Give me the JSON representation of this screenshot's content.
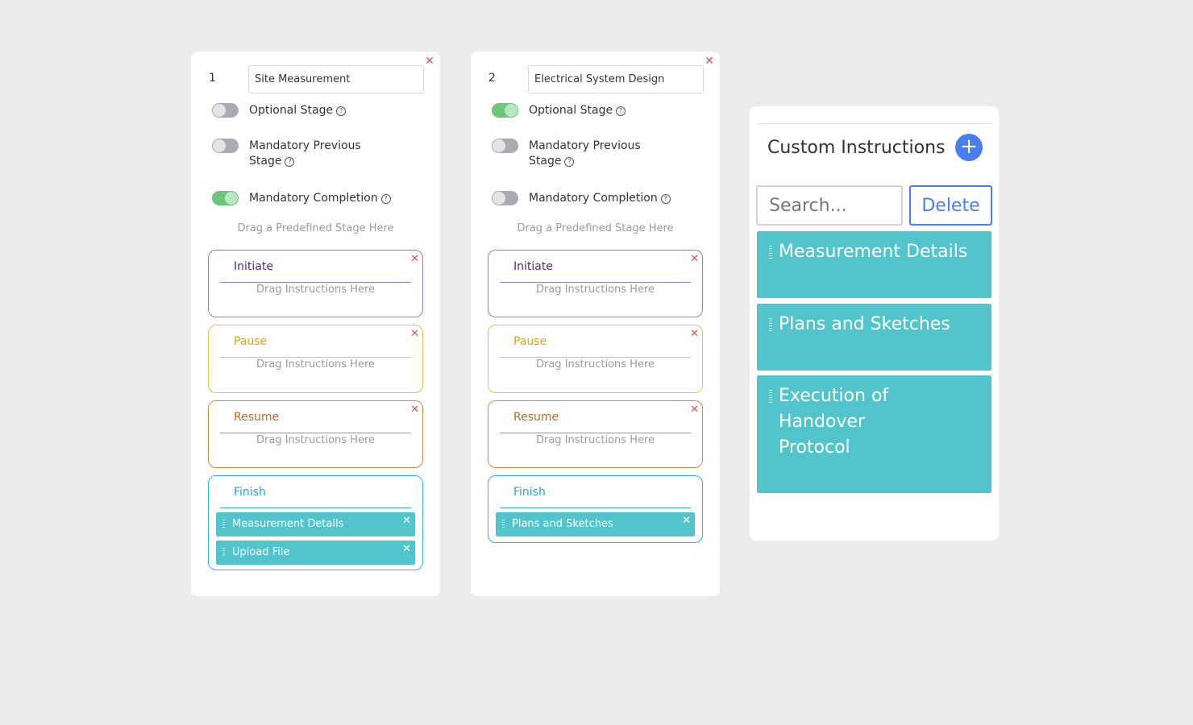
{
  "stages": [
    {
      "number": "1",
      "name": "Site Measurement",
      "options": [
        {
          "label": "Optional Stage",
          "on": false
        },
        {
          "label": "Mandatory Previous Stage",
          "on": false
        },
        {
          "label": "Mandatory Completion",
          "on": true
        }
      ],
      "drop_hint": "Drag a Predefined Stage Here",
      "sub_stages": {
        "initiate": {
          "title": "Initiate",
          "hint": "Drag Instructions Here"
        },
        "pause": {
          "title": "Pause",
          "hint": "Drag Instructions Here"
        },
        "resume": {
          "title": "Resume",
          "hint": "Drag Instructions Here"
        },
        "finish": {
          "title": "Finish",
          "items": [
            "Measurement Details",
            "Upload File"
          ]
        }
      }
    },
    {
      "number": "2",
      "name": "Electrical System Design",
      "options": [
        {
          "label": "Optional Stage",
          "on": true
        },
        {
          "label": "Mandatory Previous Stage",
          "on": false
        },
        {
          "label": "Mandatory Completion",
          "on": false
        }
      ],
      "drop_hint": "Drag a Predefined Stage Here",
      "sub_stages": {
        "initiate": {
          "title": "Initiate",
          "hint": "Drag Instructions Here"
        },
        "pause": {
          "title": "Pause",
          "hint": "Drag Instructions Here"
        },
        "resume": {
          "title": "Resume",
          "hint": "Drag Instructions Here"
        },
        "finish": {
          "title": "Finish",
          "items": [
            "Plans and Sketches"
          ]
        }
      }
    }
  ],
  "custom_instructions": {
    "title": "Custom Instructions",
    "search_placeholder": "Search...",
    "delete_label": "Delete",
    "items": [
      "Measurement Details",
      "Plans and Sketches",
      "Execution of Handover Protocol"
    ]
  },
  "icons": {
    "close": "close-icon",
    "help": "help-circle-icon",
    "add": "plus-icon",
    "drag": "drag-handle-icon"
  },
  "colors": {
    "teal": "#52c4cb",
    "accent_blue": "#4a7ef0",
    "initiate": "#9b7ab8",
    "pause": "#e2c34a",
    "resume": "#d08a3c",
    "finish": "#2fb4d8",
    "toggle_on": "#6cc67a",
    "toggle_off": "#a9abb3",
    "close_red": "#d9534f"
  }
}
